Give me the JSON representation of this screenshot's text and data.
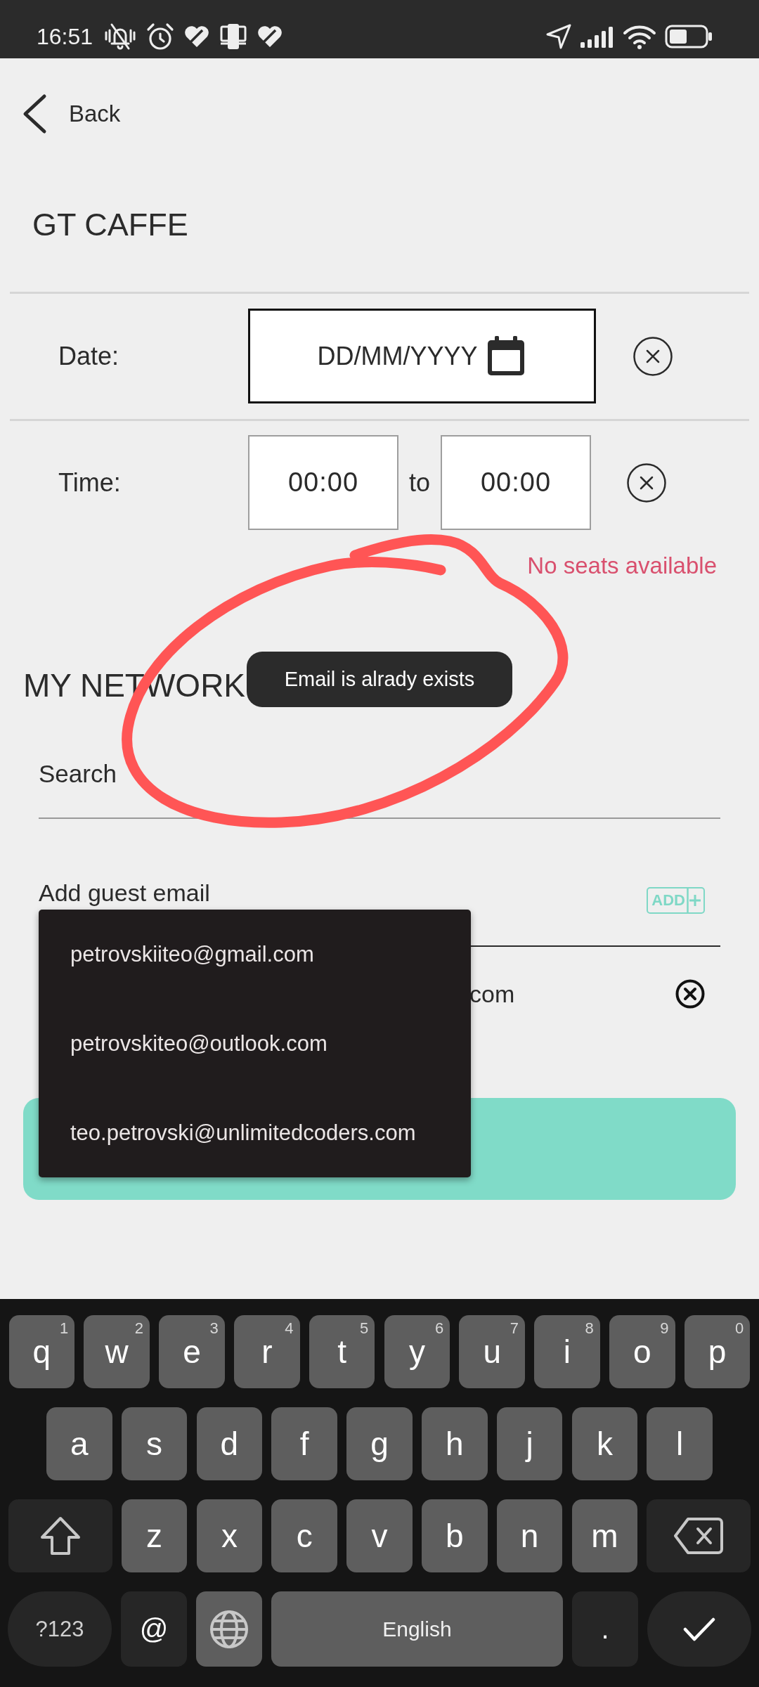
{
  "status_bar": {
    "time": "16:51"
  },
  "back_button": {
    "label": "Back"
  },
  "venue": {
    "title": "GT CAFFE"
  },
  "date_row": {
    "label": "Date:",
    "placeholder": "DD/MM/YYYY"
  },
  "time_row": {
    "label": "Time:",
    "from": "00:00",
    "separator": "to",
    "to": "00:00"
  },
  "availability_error": "No seats available",
  "network": {
    "title": "MY NETWORK",
    "search": {
      "placeholder": "Search"
    },
    "guest_email": {
      "placeholder": "Add guest email",
      "add_button": "ADD"
    },
    "guests": [
      {
        "email": "com"
      }
    ]
  },
  "toast": "Email is alrady exists",
  "suggestions": [
    {
      "email": "petrovskiiteo@gmail.com"
    },
    {
      "email": "petrovskiteo@outlook.com"
    },
    {
      "email": "teo.petrovski@unlimitedcoders.com"
    }
  ],
  "keyboard": {
    "rows": [
      {
        "keys": [
          {
            "kind": "letter",
            "label": "q",
            "hint": "1"
          },
          {
            "kind": "letter",
            "label": "w",
            "hint": "2"
          },
          {
            "kind": "letter",
            "label": "e",
            "hint": "3"
          },
          {
            "kind": "letter",
            "label": "r",
            "hint": "4"
          },
          {
            "kind": "letter",
            "label": "t",
            "hint": "5"
          },
          {
            "kind": "letter",
            "label": "y",
            "hint": "6"
          },
          {
            "kind": "letter",
            "label": "u",
            "hint": "7"
          },
          {
            "kind": "letter",
            "label": "i",
            "hint": "8"
          },
          {
            "kind": "letter",
            "label": "o",
            "hint": "9"
          },
          {
            "kind": "letter",
            "label": "p",
            "hint": "0"
          }
        ]
      },
      {
        "keys": [
          {
            "kind": "letter",
            "label": "a"
          },
          {
            "kind": "letter",
            "label": "s"
          },
          {
            "kind": "letter",
            "label": "d"
          },
          {
            "kind": "letter",
            "label": "f"
          },
          {
            "kind": "letter",
            "label": "g"
          },
          {
            "kind": "letter",
            "label": "h"
          },
          {
            "kind": "letter",
            "label": "j"
          },
          {
            "kind": "letter",
            "label": "k"
          },
          {
            "kind": "letter",
            "label": "l"
          }
        ]
      },
      {
        "keys": [
          {
            "kind": "shift"
          },
          {
            "kind": "letter",
            "label": "z"
          },
          {
            "kind": "letter",
            "label": "x"
          },
          {
            "kind": "letter",
            "label": "c"
          },
          {
            "kind": "letter",
            "label": "v"
          },
          {
            "kind": "letter",
            "label": "b"
          },
          {
            "kind": "letter",
            "label": "n"
          },
          {
            "kind": "letter",
            "label": "m"
          },
          {
            "kind": "backspace"
          }
        ]
      },
      {
        "keys": [
          {
            "kind": "symbols",
            "label": "?123"
          },
          {
            "kind": "char",
            "label": "@"
          },
          {
            "kind": "globe"
          },
          {
            "kind": "space",
            "label": "English"
          },
          {
            "kind": "char",
            "label": "."
          },
          {
            "kind": "done"
          }
        ]
      }
    ]
  }
}
